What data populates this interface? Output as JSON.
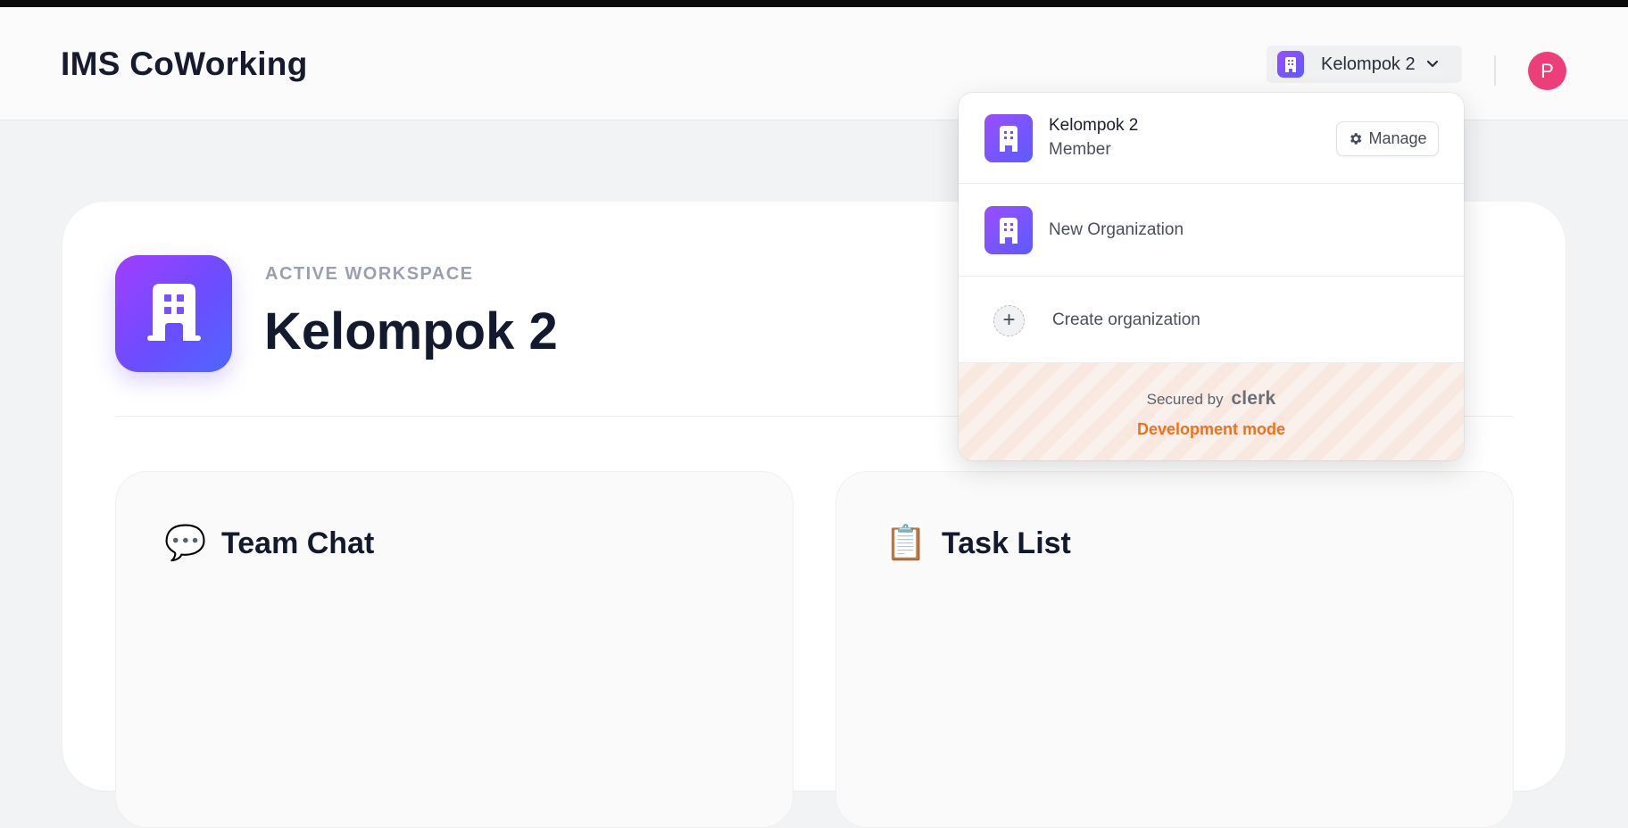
{
  "header": {
    "app_title": "IMS CoWorking",
    "org_switcher_label": "Kelompok 2",
    "avatar_initial": "P"
  },
  "workspace": {
    "eyebrow": "ACTIVE WORKSPACE",
    "name": "Kelompok 2"
  },
  "panels": {
    "chat_title": "Team Chat",
    "chat_emoji": "💬",
    "tasks_title": "Task List",
    "tasks_emoji": "📋"
  },
  "org_dropdown": {
    "active_org_name": "Kelompok 2",
    "active_org_role": "Member",
    "manage_label": "Manage",
    "other_org_name": "New Organization",
    "create_label": "Create organization",
    "secured_by": "Secured by",
    "brand": "clerk",
    "dev_mode": "Development mode"
  },
  "colors": {
    "accent_gradient_start": "#9b4dff",
    "accent_gradient_end": "#5a5cff",
    "avatar": "#ec3f7a",
    "dev_mode": "#f2701b"
  },
  "icons": [
    "building-icon",
    "chevron-down-icon",
    "gear-icon",
    "plus-icon",
    "chat-bubble-icon",
    "clipboard-icon"
  ]
}
